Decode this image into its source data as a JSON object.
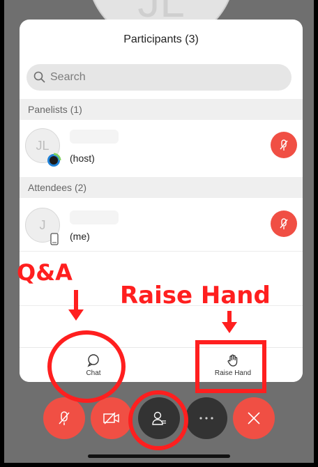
{
  "header": {
    "title": "Participants (3)"
  },
  "search": {
    "placeholder": "Search"
  },
  "sections": {
    "panelists": "Panelists (1)",
    "attendees": "Attendees (2)"
  },
  "participants": [
    {
      "initials": "JL",
      "role": "(host)"
    },
    {
      "initials": "J",
      "role": "(me)"
    }
  ],
  "tabs": {
    "chat": "Chat",
    "raise_hand": "Raise Hand"
  },
  "annotations": {
    "qa": "Q&A",
    "raise_hand": "Raise Hand"
  },
  "background_avatar": "JL",
  "colors": {
    "mute_red": "#f04f44",
    "annotation_red": "#ff1f1f",
    "dark_button": "#333333"
  }
}
